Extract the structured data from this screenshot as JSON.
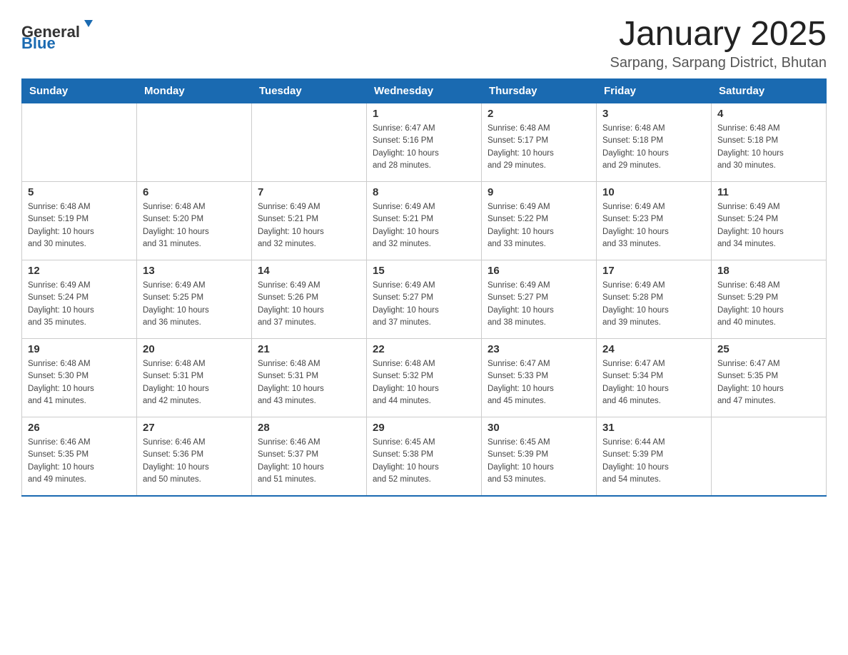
{
  "header": {
    "logo_general": "General",
    "logo_blue": "Blue",
    "title": "January 2025",
    "subtitle": "Sarpang, Sarpang District, Bhutan"
  },
  "days_of_week": [
    "Sunday",
    "Monday",
    "Tuesday",
    "Wednesday",
    "Thursday",
    "Friday",
    "Saturday"
  ],
  "weeks": [
    [
      {
        "day": "",
        "info": ""
      },
      {
        "day": "",
        "info": ""
      },
      {
        "day": "",
        "info": ""
      },
      {
        "day": "1",
        "info": "Sunrise: 6:47 AM\nSunset: 5:16 PM\nDaylight: 10 hours\nand 28 minutes."
      },
      {
        "day": "2",
        "info": "Sunrise: 6:48 AM\nSunset: 5:17 PM\nDaylight: 10 hours\nand 29 minutes."
      },
      {
        "day": "3",
        "info": "Sunrise: 6:48 AM\nSunset: 5:18 PM\nDaylight: 10 hours\nand 29 minutes."
      },
      {
        "day": "4",
        "info": "Sunrise: 6:48 AM\nSunset: 5:18 PM\nDaylight: 10 hours\nand 30 minutes."
      }
    ],
    [
      {
        "day": "5",
        "info": "Sunrise: 6:48 AM\nSunset: 5:19 PM\nDaylight: 10 hours\nand 30 minutes."
      },
      {
        "day": "6",
        "info": "Sunrise: 6:48 AM\nSunset: 5:20 PM\nDaylight: 10 hours\nand 31 minutes."
      },
      {
        "day": "7",
        "info": "Sunrise: 6:49 AM\nSunset: 5:21 PM\nDaylight: 10 hours\nand 32 minutes."
      },
      {
        "day": "8",
        "info": "Sunrise: 6:49 AM\nSunset: 5:21 PM\nDaylight: 10 hours\nand 32 minutes."
      },
      {
        "day": "9",
        "info": "Sunrise: 6:49 AM\nSunset: 5:22 PM\nDaylight: 10 hours\nand 33 minutes."
      },
      {
        "day": "10",
        "info": "Sunrise: 6:49 AM\nSunset: 5:23 PM\nDaylight: 10 hours\nand 33 minutes."
      },
      {
        "day": "11",
        "info": "Sunrise: 6:49 AM\nSunset: 5:24 PM\nDaylight: 10 hours\nand 34 minutes."
      }
    ],
    [
      {
        "day": "12",
        "info": "Sunrise: 6:49 AM\nSunset: 5:24 PM\nDaylight: 10 hours\nand 35 minutes."
      },
      {
        "day": "13",
        "info": "Sunrise: 6:49 AM\nSunset: 5:25 PM\nDaylight: 10 hours\nand 36 minutes."
      },
      {
        "day": "14",
        "info": "Sunrise: 6:49 AM\nSunset: 5:26 PM\nDaylight: 10 hours\nand 37 minutes."
      },
      {
        "day": "15",
        "info": "Sunrise: 6:49 AM\nSunset: 5:27 PM\nDaylight: 10 hours\nand 37 minutes."
      },
      {
        "day": "16",
        "info": "Sunrise: 6:49 AM\nSunset: 5:27 PM\nDaylight: 10 hours\nand 38 minutes."
      },
      {
        "day": "17",
        "info": "Sunrise: 6:49 AM\nSunset: 5:28 PM\nDaylight: 10 hours\nand 39 minutes."
      },
      {
        "day": "18",
        "info": "Sunrise: 6:48 AM\nSunset: 5:29 PM\nDaylight: 10 hours\nand 40 minutes."
      }
    ],
    [
      {
        "day": "19",
        "info": "Sunrise: 6:48 AM\nSunset: 5:30 PM\nDaylight: 10 hours\nand 41 minutes."
      },
      {
        "day": "20",
        "info": "Sunrise: 6:48 AM\nSunset: 5:31 PM\nDaylight: 10 hours\nand 42 minutes."
      },
      {
        "day": "21",
        "info": "Sunrise: 6:48 AM\nSunset: 5:31 PM\nDaylight: 10 hours\nand 43 minutes."
      },
      {
        "day": "22",
        "info": "Sunrise: 6:48 AM\nSunset: 5:32 PM\nDaylight: 10 hours\nand 44 minutes."
      },
      {
        "day": "23",
        "info": "Sunrise: 6:47 AM\nSunset: 5:33 PM\nDaylight: 10 hours\nand 45 minutes."
      },
      {
        "day": "24",
        "info": "Sunrise: 6:47 AM\nSunset: 5:34 PM\nDaylight: 10 hours\nand 46 minutes."
      },
      {
        "day": "25",
        "info": "Sunrise: 6:47 AM\nSunset: 5:35 PM\nDaylight: 10 hours\nand 47 minutes."
      }
    ],
    [
      {
        "day": "26",
        "info": "Sunrise: 6:46 AM\nSunset: 5:35 PM\nDaylight: 10 hours\nand 49 minutes."
      },
      {
        "day": "27",
        "info": "Sunrise: 6:46 AM\nSunset: 5:36 PM\nDaylight: 10 hours\nand 50 minutes."
      },
      {
        "day": "28",
        "info": "Sunrise: 6:46 AM\nSunset: 5:37 PM\nDaylight: 10 hours\nand 51 minutes."
      },
      {
        "day": "29",
        "info": "Sunrise: 6:45 AM\nSunset: 5:38 PM\nDaylight: 10 hours\nand 52 minutes."
      },
      {
        "day": "30",
        "info": "Sunrise: 6:45 AM\nSunset: 5:39 PM\nDaylight: 10 hours\nand 53 minutes."
      },
      {
        "day": "31",
        "info": "Sunrise: 6:44 AM\nSunset: 5:39 PM\nDaylight: 10 hours\nand 54 minutes."
      },
      {
        "day": "",
        "info": ""
      }
    ]
  ]
}
